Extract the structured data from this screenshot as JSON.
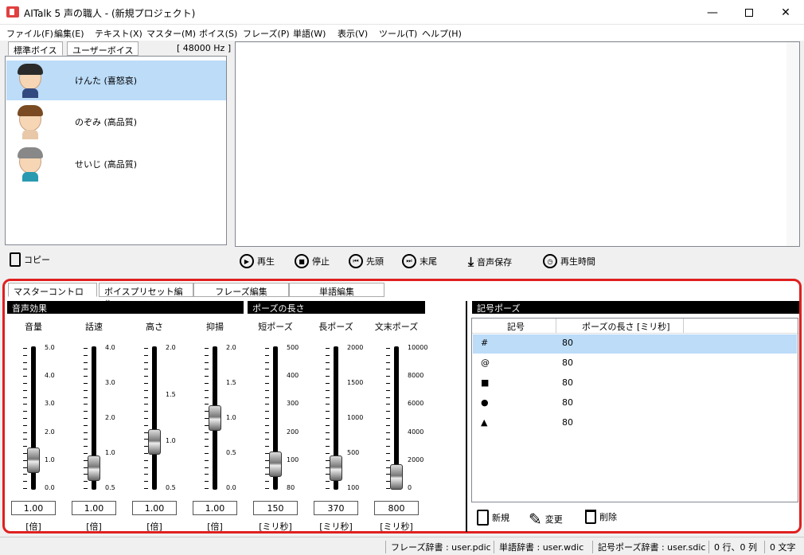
{
  "window": {
    "title": "AITalk 5 声の職人 - (新規プロジェクト)",
    "min_icon": "minimize-icon",
    "max_icon": "maximize-icon",
    "close_icon": "close-icon"
  },
  "menu": [
    "ファイル(F)",
    "編集(E)",
    "テキスト(X)",
    "マスター(M)",
    "ボイス(S)",
    "フレーズ(P)",
    "単語(W)",
    "表示(V)",
    "ツール(T)",
    "ヘルプ(H)"
  ],
  "voice_panel": {
    "tabs": [
      "標準ボイス",
      "ユーザーボイス"
    ],
    "sample_rate": "[ 48000 Hz ]",
    "voices": [
      {
        "name": "けんた (喜怒哀)",
        "selected": true
      },
      {
        "name": "のぞみ (高品質)",
        "selected": false
      },
      {
        "name": "せいじ (高品質)",
        "selected": false
      }
    ],
    "copy_label": "コピー"
  },
  "playback": {
    "play": "再生",
    "stop": "停止",
    "head": "先頭",
    "tail": "末尾",
    "save": "音声保存",
    "time": "再生時間"
  },
  "lower_tabs": [
    "マスターコントロール",
    "ボイスプリセット編集",
    "フレーズ編集",
    "単語編集"
  ],
  "sections": {
    "effects": "音声効果",
    "pause_length": "ポーズの長さ",
    "symbol_pause": "記号ポーズ"
  },
  "sliders": [
    {
      "label": "音量",
      "value": "1.00",
      "unit": "[倍]",
      "scale": [
        "5.0",
        "4.0",
        "3.0",
        "2.0",
        "1.0",
        "0.0"
      ],
      "level": 0.2
    },
    {
      "label": "話速",
      "value": "1.00",
      "unit": "[倍]",
      "scale": [
        "4.0",
        "3.0",
        "2.0",
        "1.0",
        "0.5"
      ],
      "level": 0.14
    },
    {
      "label": "高さ",
      "value": "1.00",
      "unit": "[倍]",
      "scale": [
        "2.0",
        "1.5",
        "1.0",
        "0.5"
      ],
      "level": 0.33
    },
    {
      "label": "抑揚",
      "value": "1.00",
      "unit": "[倍]",
      "scale": [
        "2.0",
        "1.5",
        "1.0",
        "0.5",
        "0.0"
      ],
      "level": 0.5
    },
    {
      "label": "短ポーズ",
      "value": "150",
      "unit": "[ミリ秒]",
      "scale": [
        "500",
        "400",
        "300",
        "200",
        "100",
        "80"
      ],
      "level": 0.17
    },
    {
      "label": "長ポーズ",
      "value": "370",
      "unit": "[ミリ秒]",
      "scale": [
        "2000",
        "1500",
        "1000",
        "500",
        "100"
      ],
      "level": 0.14
    },
    {
      "label": "文末ポーズ",
      "value": "800",
      "unit": "[ミリ秒]",
      "scale": [
        "10000",
        "8000",
        "6000",
        "4000",
        "2000",
        "0"
      ],
      "level": 0.08
    }
  ],
  "pause_table": {
    "headers": [
      "記号",
      "ポーズの長さ [ミリ秒]"
    ],
    "rows": [
      {
        "symbol": "#",
        "length": "80",
        "selected": true
      },
      {
        "symbol": "@",
        "length": "80",
        "selected": false
      },
      {
        "symbol": "■",
        "length": "80",
        "selected": false
      },
      {
        "symbol": "●",
        "length": "80",
        "selected": false
      },
      {
        "symbol": "▲",
        "length": "80",
        "selected": false
      }
    ],
    "new_label": "新規",
    "edit_label": "変更",
    "delete_label": "削除"
  },
  "status": {
    "phrase_dict": "フレーズ辞書 : user.pdic",
    "word_dict": "単語辞書 : user.wdic",
    "symbol_dict": "記号ポーズ辞書 : user.sdic",
    "position": "0 行、0 列",
    "chars": "0 文字"
  }
}
